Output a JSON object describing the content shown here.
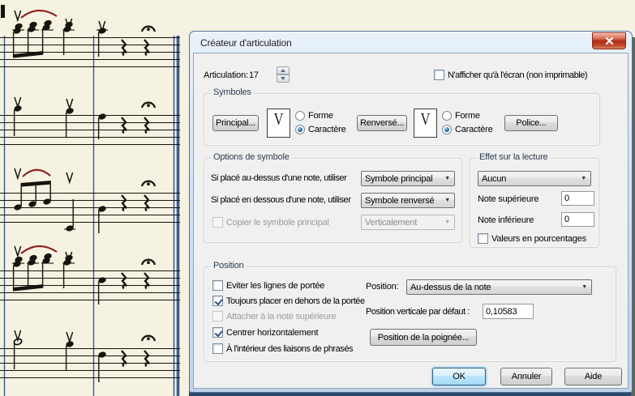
{
  "window": {
    "title": "Créateur d'articulation"
  },
  "articulation": {
    "label": "Articulation:",
    "value": "17"
  },
  "screen_only": {
    "label": "N'afficher qu'à l'écran (non imprimable)",
    "checked": false
  },
  "symbols": {
    "group_label": "Symboles",
    "principal_button": "Principal...",
    "renverse_button": "Renversé...",
    "police_button": "Police...",
    "main_symbol": "V",
    "reverse_symbol": "V",
    "main": {
      "forme_label": "Forme",
      "caractere_label": "Caractère",
      "forme_selected": false,
      "caractere_selected": true
    },
    "reverse": {
      "forme_label": "Forme",
      "caractere_label": "Caractère",
      "forme_selected": false,
      "caractere_selected": true
    }
  },
  "symbol_options": {
    "group_label": "Options de symbole",
    "above_label": "Si placé au-dessus d'une note, utiliser",
    "above_value": "Symbole principal",
    "below_label": "Si placé en dessous d'une note, utiliser",
    "below_value": "Symbole renversé",
    "copy": {
      "label": "Copier le symbole principal",
      "checked": false,
      "disabled": true
    },
    "copy_mode_value": "Verticalement"
  },
  "playback": {
    "group_label": "Effet sur la lecture",
    "effect_value": "Aucun",
    "top_note_label": "Note supérieure",
    "top_note_value": "0",
    "bottom_note_label": "Note inférieure",
    "bottom_note_value": "0",
    "percent": {
      "label": "Valeurs en pourcentages",
      "checked": false
    }
  },
  "position": {
    "group_label": "Position",
    "avoid_staff": {
      "label": "Eviter les lignes de portée",
      "checked": false
    },
    "outside_staff": {
      "label": "Toujours placer en dehors de la portée",
      "checked": true
    },
    "attach_top": {
      "label": "Attacher à la note supérieure",
      "checked": false,
      "disabled": true
    },
    "center_h": {
      "label": "Centrer horizontalement",
      "checked": true
    },
    "inside_slurs": {
      "label": "À l'intérieur des liaisons de phrasés",
      "checked": false
    },
    "position_label": "Position:",
    "position_value": "Au-dessus de la note",
    "vertical_label": "Position verticale par défaut :",
    "vertical_value": "0,10583",
    "handle_button": "Position de la poignée..."
  },
  "footer": {
    "ok": "OK",
    "cancel": "Annuler",
    "help": "Aide"
  },
  "colors": {
    "accent_check": "#2b4f8e",
    "close_button_red": "#b8321c",
    "barline_blue": "#3a5a8f",
    "slur_red": "#8e2420",
    "paper": "#f6f2e2",
    "dialog_face": "#f0f0f0"
  }
}
